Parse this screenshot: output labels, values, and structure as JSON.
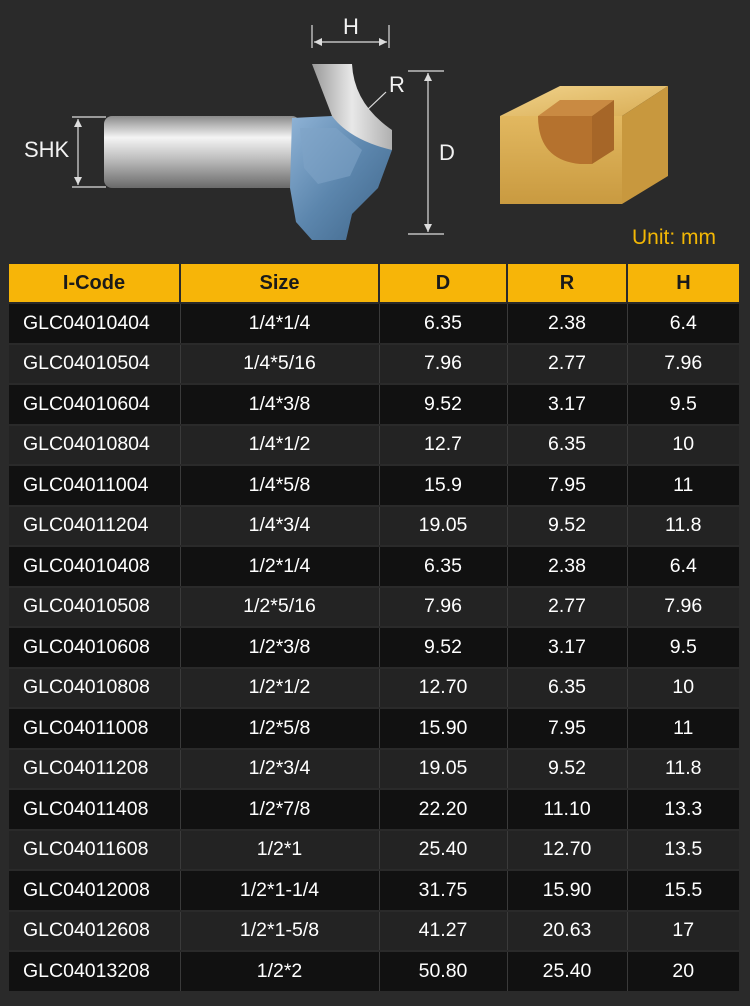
{
  "diagram": {
    "label_h": "H",
    "label_r": "R",
    "label_shk": "SHK",
    "label_d": "D",
    "unit": "Unit: mm",
    "colors": {
      "accent": "#f7b508",
      "blue": "#6b93b8",
      "wood": "#e7c373"
    }
  },
  "table": {
    "headers": [
      "I-Code",
      "Size",
      "D",
      "R",
      "H"
    ],
    "rows": [
      [
        "GLC04010404",
        "1/4*1/4",
        "6.35",
        "2.38",
        "6.4"
      ],
      [
        "GLC04010504",
        "1/4*5/16",
        "7.96",
        "2.77",
        "7.96"
      ],
      [
        "GLC04010604",
        "1/4*3/8",
        "9.52",
        "3.17",
        "9.5"
      ],
      [
        "GLC04010804",
        "1/4*1/2",
        "12.7",
        "6.35",
        "10"
      ],
      [
        "GLC04011004",
        "1/4*5/8",
        "15.9",
        "7.95",
        "11"
      ],
      [
        "GLC04011204",
        "1/4*3/4",
        "19.05",
        "9.52",
        "11.8"
      ],
      [
        "GLC04010408",
        "1/2*1/4",
        "6.35",
        "2.38",
        "6.4"
      ],
      [
        "GLC04010508",
        "1/2*5/16",
        "7.96",
        "2.77",
        "7.96"
      ],
      [
        "GLC04010608",
        "1/2*3/8",
        "9.52",
        "3.17",
        "9.5"
      ],
      [
        "GLC04010808",
        "1/2*1/2",
        "12.70",
        "6.35",
        "10"
      ],
      [
        "GLC04011008",
        "1/2*5/8",
        "15.90",
        "7.95",
        "11"
      ],
      [
        "GLC04011208",
        "1/2*3/4",
        "19.05",
        "9.52",
        "11.8"
      ],
      [
        "GLC04011408",
        "1/2*7/8",
        "22.20",
        "11.10",
        "13.3"
      ],
      [
        "GLC04011608",
        "1/2*1",
        "25.40",
        "12.70",
        "13.5"
      ],
      [
        "GLC04012008",
        "1/2*1-1/4",
        "31.75",
        "15.90",
        "15.5"
      ],
      [
        "GLC04012608",
        "1/2*1-5/8",
        "41.27",
        "20.63",
        "17"
      ],
      [
        "GLC04013208",
        "1/2*2",
        "50.80",
        "25.40",
        "20"
      ]
    ]
  }
}
